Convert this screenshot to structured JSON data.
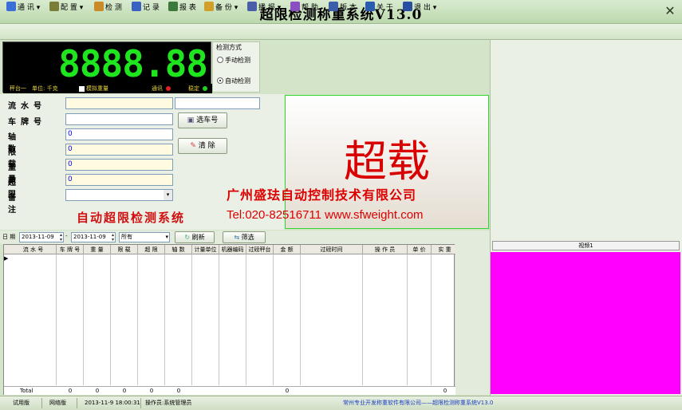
{
  "window": {
    "title": "超限检测称重系统V13.0",
    "close_glyph": "✕"
  },
  "menu": [
    {
      "label": "通 讯",
      "has_dropdown": true,
      "icon": "wrench-icon",
      "color": "#3a6fd8"
    },
    {
      "label": "配 置",
      "has_dropdown": true,
      "icon": "gears-icon",
      "color": "#7d7d3a"
    },
    {
      "label": "检 测",
      "has_dropdown": false,
      "icon": "scale-icon",
      "color": "#c98a2a"
    },
    {
      "label": "记 录",
      "has_dropdown": false,
      "icon": "table-icon",
      "color": "#3a62c0"
    },
    {
      "label": "报 表",
      "has_dropdown": false,
      "icon": "report-icon",
      "color": "#3b7a3b"
    },
    {
      "label": "备 份",
      "has_dropdown": true,
      "icon": "backup-icon",
      "color": "#d0a02a"
    },
    {
      "label": "播 报",
      "has_dropdown": true,
      "icon": "speaker-icon",
      "color": "#4b5fa8"
    },
    {
      "label": "帮 助",
      "has_dropdown": false,
      "icon": "help-icon",
      "color": "#8a4fc0"
    },
    {
      "label": "版 本",
      "has_dropdown": false,
      "icon": "version-icon",
      "color": "#3a5fa8"
    },
    {
      "label": "关 于",
      "has_dropdown": false,
      "icon": "info-icon",
      "color": "#2a5cb0"
    },
    {
      "label": "退 出",
      "has_dropdown": true,
      "icon": "exit-icon",
      "color": "#2a4fa0"
    }
  ],
  "display": {
    "weight": "8888.88",
    "status": {
      "platform": "秤台一",
      "unit": "单位: 千克",
      "simulate": "模拟重量",
      "comm": "通讯",
      "stable": "稳定"
    },
    "colors": {
      "digits": "#1ee51e",
      "comm_led": "#e02020",
      "stable_led": "#20d020"
    }
  },
  "mode": {
    "title": "检测方式",
    "options": [
      {
        "label": "手动检测",
        "selected": false
      },
      {
        "label": "自动检测",
        "selected": true
      }
    ]
  },
  "form": {
    "fields": [
      {
        "label": "流水号",
        "value": ""
      },
      {
        "label": "车牌号",
        "value": ""
      },
      {
        "label": "轴数",
        "value": "0"
      },
      {
        "label": "限载",
        "value": "0"
      },
      {
        "label": "重量",
        "value": "0"
      },
      {
        "label": "超限",
        "value": "0"
      },
      {
        "label": "备注",
        "value": ""
      }
    ],
    "choose_plate_button": "选车号",
    "clear_button": "清 除",
    "brand_text": "自动超限检测系统"
  },
  "overload": {
    "text": "超载",
    "company": "广州盛珐自动控制技术有限公司",
    "contact": "Tel:020-82516711 www.sfweight.com"
  },
  "filter": {
    "date_label": "日 期",
    "date_from": "2013-11-09",
    "date_to": "2013-11-09",
    "separator": "-",
    "scope": "所有",
    "refresh_button": "刷新",
    "filter_button": "筛选"
  },
  "table": {
    "columns": [
      "流 水 号",
      "车 牌 号",
      "重 量",
      "限 载",
      "超 限",
      "轴 数",
      "计量单位",
      "机器编码",
      "过磅秤台",
      "金 额",
      "过磅时间",
      "操 作 员",
      "单 价",
      "实 重"
    ],
    "total_label": "Total",
    "totals": [
      "",
      "0",
      "0",
      "0",
      "0",
      "0",
      "",
      "",
      "",
      "0",
      "",
      "",
      "",
      "0"
    ]
  },
  "video": {
    "label": "视频1",
    "color": "#ff00ff"
  },
  "status": {
    "trial": "试用版",
    "network": "网络版",
    "datetime": "2013-11-9 18:00:31",
    "operator": "操作员:系统管理员",
    "copyright": "常州专业开发称重软件有限公司——超限检测称重系统V13.0"
  }
}
